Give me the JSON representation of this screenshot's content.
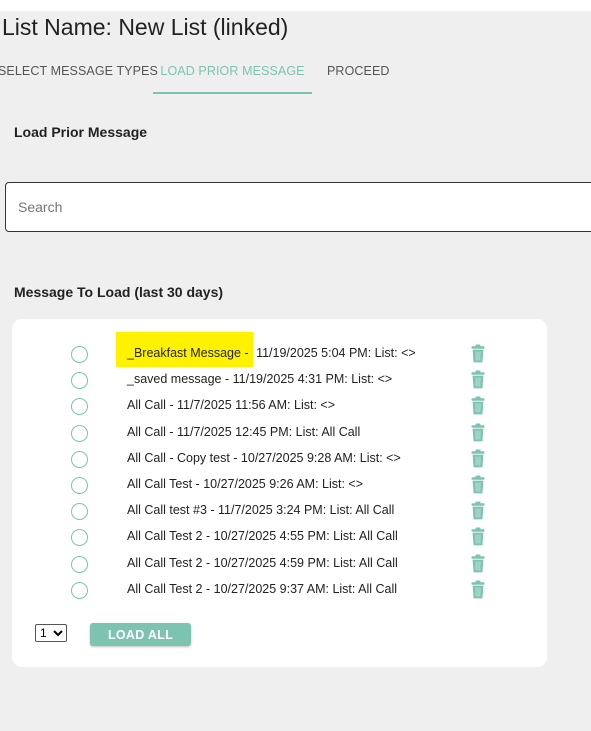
{
  "header": {
    "title": "List Name: New List (linked)"
  },
  "tabs": [
    {
      "label": "SELECT MESSAGE TYPES",
      "active": false
    },
    {
      "label": "LOAD PRIOR MESSAGE",
      "active": true
    },
    {
      "label": "PROCEED",
      "active": false
    }
  ],
  "load_section": {
    "heading": "Load Prior Message"
  },
  "search": {
    "placeholder": "Search",
    "value": ""
  },
  "messages_section": {
    "heading": "Message To Load (last 30 days)"
  },
  "messages": [
    {
      "name": "_Breakfast Message -",
      "details": " 11/19/2025 5:04 PM: List: <>",
      "highlighted": true
    },
    {
      "name": "_saved message -",
      "details": " 11/19/2025 4:31 PM: List: <>"
    },
    {
      "name": "All Call -",
      "details": " 11/7/2025 11:56 AM: List: <>"
    },
    {
      "name": "All Call -",
      "details": " 11/7/2025 12:45 PM: List: All Call"
    },
    {
      "name": "All Call - Copy test -",
      "details": " 10/27/2025 9:28 AM: List: <>"
    },
    {
      "name": "All Call Test -",
      "details": " 10/27/2025 9:26 AM: List: <>"
    },
    {
      "name": "All Call test #3 -",
      "details": " 11/7/2025 3:24 PM: List: All Call"
    },
    {
      "name": "All Call Test 2 -",
      "details": " 10/27/2025 4:55 PM: List: All Call"
    },
    {
      "name": "All Call Test 2 -",
      "details": " 10/27/2025 4:59 PM: List: All Call"
    },
    {
      "name": "All Call Test 2 -",
      "details": " 10/27/2025 9:37 AM: List: All Call"
    }
  ],
  "pagination": {
    "selected_page": "1",
    "options": [
      "1"
    ]
  },
  "actions": {
    "load_all_label": "LOAD ALL"
  },
  "icons": {
    "radio": "radio-unchecked-icon",
    "delete": "trash-icon"
  },
  "colors": {
    "accent": "#7cc3b2",
    "highlight": "#fff200",
    "background": "#efefef"
  }
}
